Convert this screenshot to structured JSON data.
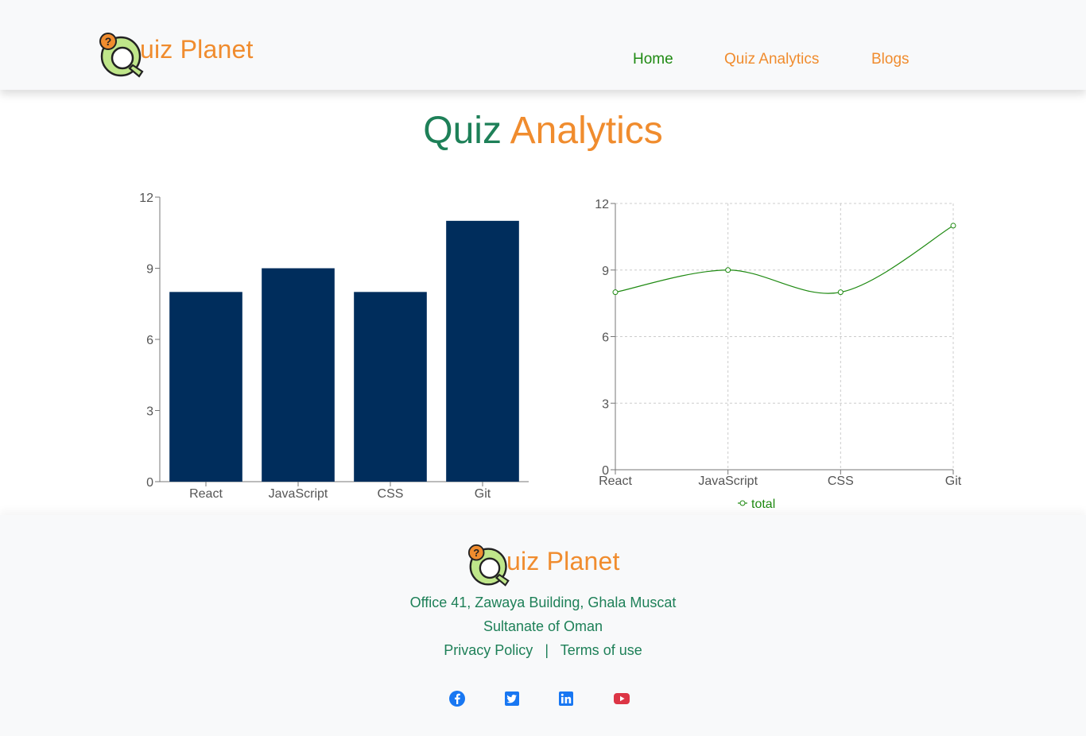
{
  "brand": {
    "name": "uiz Planet",
    "logo_icon": "quiz-planet-logo-icon"
  },
  "nav": {
    "home": "Home",
    "quiz_analytics": "Quiz Analytics",
    "blogs": "Blogs",
    "active_color": "#1f8a12",
    "link_color": "#f08c2e"
  },
  "page_title": {
    "part1": "Quiz",
    "part2": "Analytics"
  },
  "chart_data": [
    {
      "type": "bar",
      "categories": [
        "React",
        "JavaScript",
        "CSS",
        "Git"
      ],
      "values": [
        8,
        9,
        8,
        11
      ],
      "y_ticks": [
        "0",
        "3",
        "6",
        "9",
        "12"
      ],
      "ylim": [
        0,
        12
      ],
      "grid": false,
      "bar_color": "#002d5c"
    },
    {
      "type": "line",
      "categories": [
        "React",
        "JavaScript",
        "CSS",
        "Git"
      ],
      "series": [
        {
          "name": "total",
          "values": [
            8,
            9,
            8,
            11
          ]
        }
      ],
      "y_ticks": [
        "0",
        "3",
        "6",
        "9",
        "12"
      ],
      "ylim": [
        0,
        12
      ],
      "grid": true,
      "legend_position": "bottom",
      "line_color": "#1f8a12"
    }
  ],
  "footer": {
    "brand_name": "uiz Planet",
    "address_line1": "Office 41, Zawaya Building, Ghala Muscat",
    "address_line2": "Sultanate of Oman",
    "privacy": "Privacy Policy",
    "separator": "|",
    "terms": "Terms of use",
    "social": [
      "facebook-icon",
      "twitter-icon",
      "linkedin-icon",
      "youtube-icon"
    ]
  }
}
